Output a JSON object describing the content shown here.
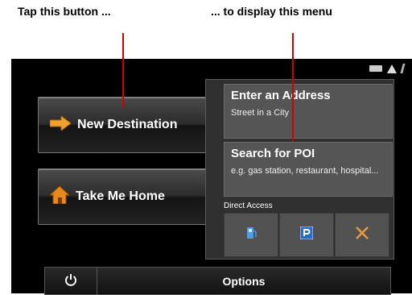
{
  "annotations": {
    "left": "Tap this button ...",
    "right": "... to display this menu"
  },
  "main_buttons": {
    "new_destination": "New Destination",
    "take_me_home": "Take Me Home"
  },
  "menu": {
    "enter_address": {
      "title": "Enter an Address",
      "subtitle": "Street in a City"
    },
    "search_poi": {
      "title": "Search for POI",
      "subtitle": "e.g. gas station, restaurant, hospital..."
    },
    "direct_access_label": "Direct Access",
    "direct_access_icons": [
      "fuel-icon",
      "parking-icon",
      "restaurant-icon"
    ]
  },
  "bottom_bar": {
    "options_label": "Options",
    "power_icon": "power-icon"
  },
  "status_icons": [
    "battery-icon",
    "warning-icon",
    "satellite-icon"
  ],
  "colors": {
    "annotation_line": "#d40000",
    "arrow_orange": "#f0a030",
    "house_orange": "#e8891c"
  }
}
